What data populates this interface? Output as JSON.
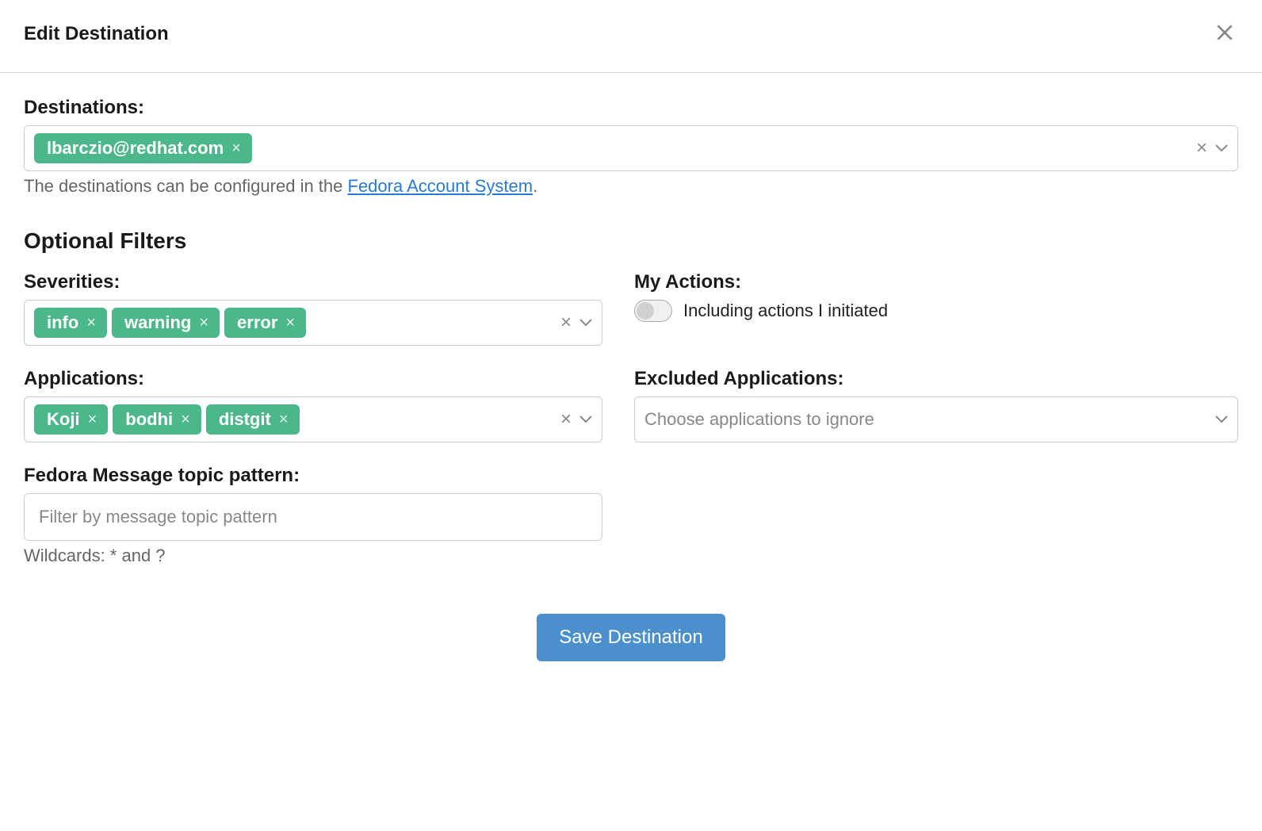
{
  "modal": {
    "title": "Edit Destination"
  },
  "destinations": {
    "label": "Destinations:",
    "tags": [
      "lbarczio@redhat.com"
    ],
    "helper_prefix": "The destinations can be configured in the ",
    "helper_link": "Fedora Account System",
    "helper_suffix": "."
  },
  "section": {
    "title": "Optional Filters"
  },
  "severities": {
    "label": "Severities:",
    "tags": [
      "info",
      "warning",
      "error"
    ]
  },
  "my_actions": {
    "label": "My Actions:",
    "toggle_label": "Including actions I initiated",
    "checked": false
  },
  "applications": {
    "label": "Applications:",
    "tags": [
      "Koji",
      "bodhi",
      "distgit"
    ]
  },
  "excluded": {
    "label": "Excluded Applications:",
    "placeholder": "Choose applications to ignore"
  },
  "topic": {
    "label": "Fedora Message topic pattern:",
    "placeholder": "Filter by message topic pattern",
    "helper": "Wildcards: * and ?"
  },
  "save": {
    "label": "Save Destination"
  }
}
